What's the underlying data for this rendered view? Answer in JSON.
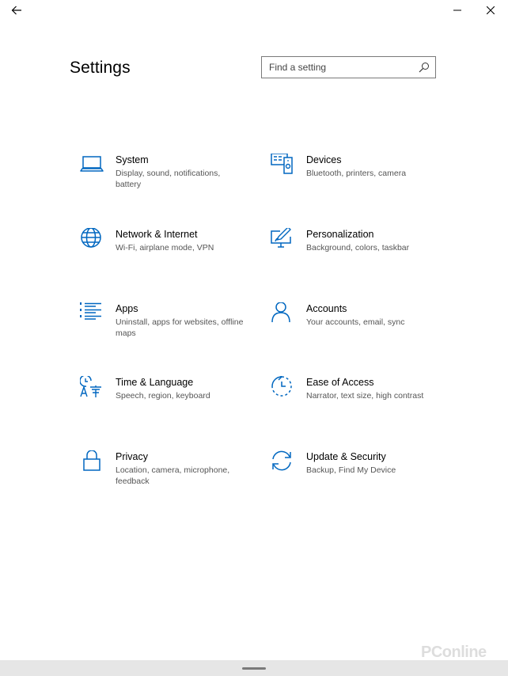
{
  "window": {
    "title": "Settings"
  },
  "search": {
    "placeholder": "Find a setting"
  },
  "colors": {
    "accent": "#0067c0",
    "text": "#000000",
    "subtext": "#555555"
  },
  "categories": [
    {
      "title": "System",
      "desc": "Display, sound, notifications, battery",
      "icon": "laptop-icon"
    },
    {
      "title": "Devices",
      "desc": "Bluetooth, printers, camera",
      "icon": "devices-icon"
    },
    {
      "title": "Network & Internet",
      "desc": "Wi-Fi, airplane mode, VPN",
      "icon": "globe-icon"
    },
    {
      "title": "Personalization",
      "desc": "Background, colors, taskbar",
      "icon": "personalization-icon"
    },
    {
      "title": "Apps",
      "desc": "Uninstall, apps for websites, offline maps",
      "icon": "apps-list-icon"
    },
    {
      "title": "Accounts",
      "desc": "Your accounts, email, sync",
      "icon": "person-icon"
    },
    {
      "title": "Time & Language",
      "desc": "Speech, region, keyboard",
      "icon": "time-language-icon"
    },
    {
      "title": "Ease of Access",
      "desc": "Narrator, text size, high contrast",
      "icon": "ease-of-access-icon"
    },
    {
      "title": "Privacy",
      "desc": "Location, camera, microphone, feedback",
      "icon": "lock-icon"
    },
    {
      "title": "Update & Security",
      "desc": "Backup, Find My Device",
      "icon": "update-icon"
    }
  ],
  "watermark": "PConline"
}
